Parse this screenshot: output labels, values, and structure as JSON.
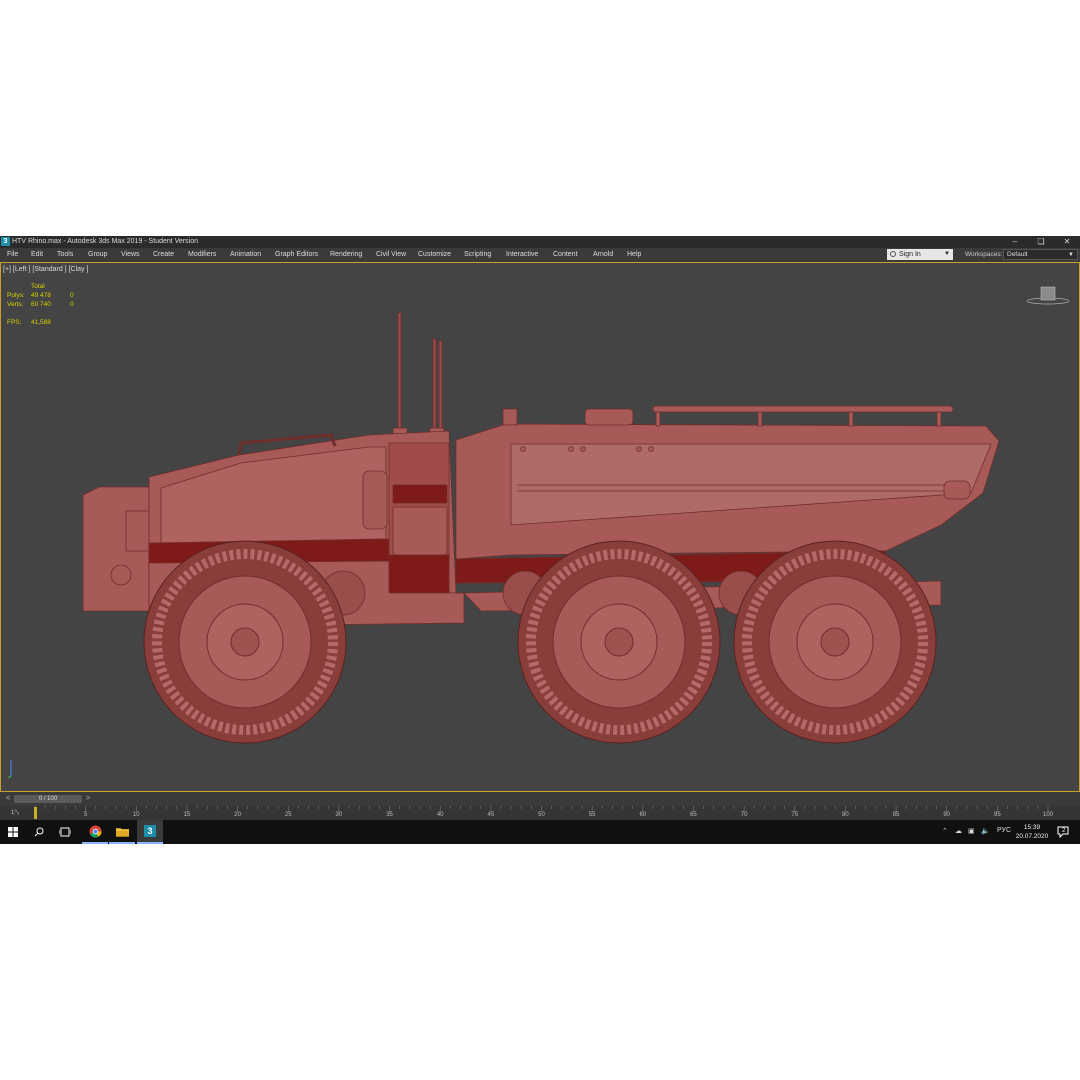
{
  "window": {
    "title": "HTV Rhino.max - Autodesk 3ds Max 2019 - Student Version",
    "app_icon_glyph": "3",
    "controls": [
      "minimize-icon",
      "restore-icon",
      "close-icon"
    ]
  },
  "menu": {
    "items": [
      "File",
      "Edit",
      "Tools",
      "Group",
      "Views",
      "Create",
      "Modifiers",
      "Animation",
      "Graph Editors",
      "Rendering",
      "Civil View",
      "Customize",
      "Scripting",
      "Interactive",
      "Content",
      "Arnold",
      "Help"
    ],
    "sign_in": "Sign In",
    "workspaces_label": "Workspaces:",
    "workspaces_value": "Default"
  },
  "viewport": {
    "label": "[+] [Left ] [Standard ] [Clay ]",
    "stats": {
      "total_header": "Total",
      "polys_label": "Polys:",
      "polys_value": "49 478",
      "polys_sel": "0",
      "verts_label": "Verts:",
      "verts_value": "60 740",
      "verts_sel": "0",
      "fps_label": "FPS:",
      "fps_value": "41,588"
    },
    "model_color": "#a85a58",
    "border_color": "#c8a02a"
  },
  "timeline": {
    "slider_text": "0 / 100",
    "zoom_label": "1⁰₀",
    "tick_labels": [
      "5",
      "10",
      "15",
      "20",
      "25",
      "30",
      "35",
      "40",
      "45",
      "50",
      "55",
      "60",
      "65",
      "70",
      "75",
      "80",
      "85",
      "90",
      "95",
      "100"
    ]
  },
  "taskbar": {
    "apps": [
      "windows-start-icon",
      "search-icon",
      "task-view-icon",
      "chrome-icon",
      "file-explorer-icon",
      "3ds-max-icon"
    ],
    "language": "РУС",
    "time": "15:39",
    "date": "20.07.2020",
    "notification_count": "2"
  }
}
